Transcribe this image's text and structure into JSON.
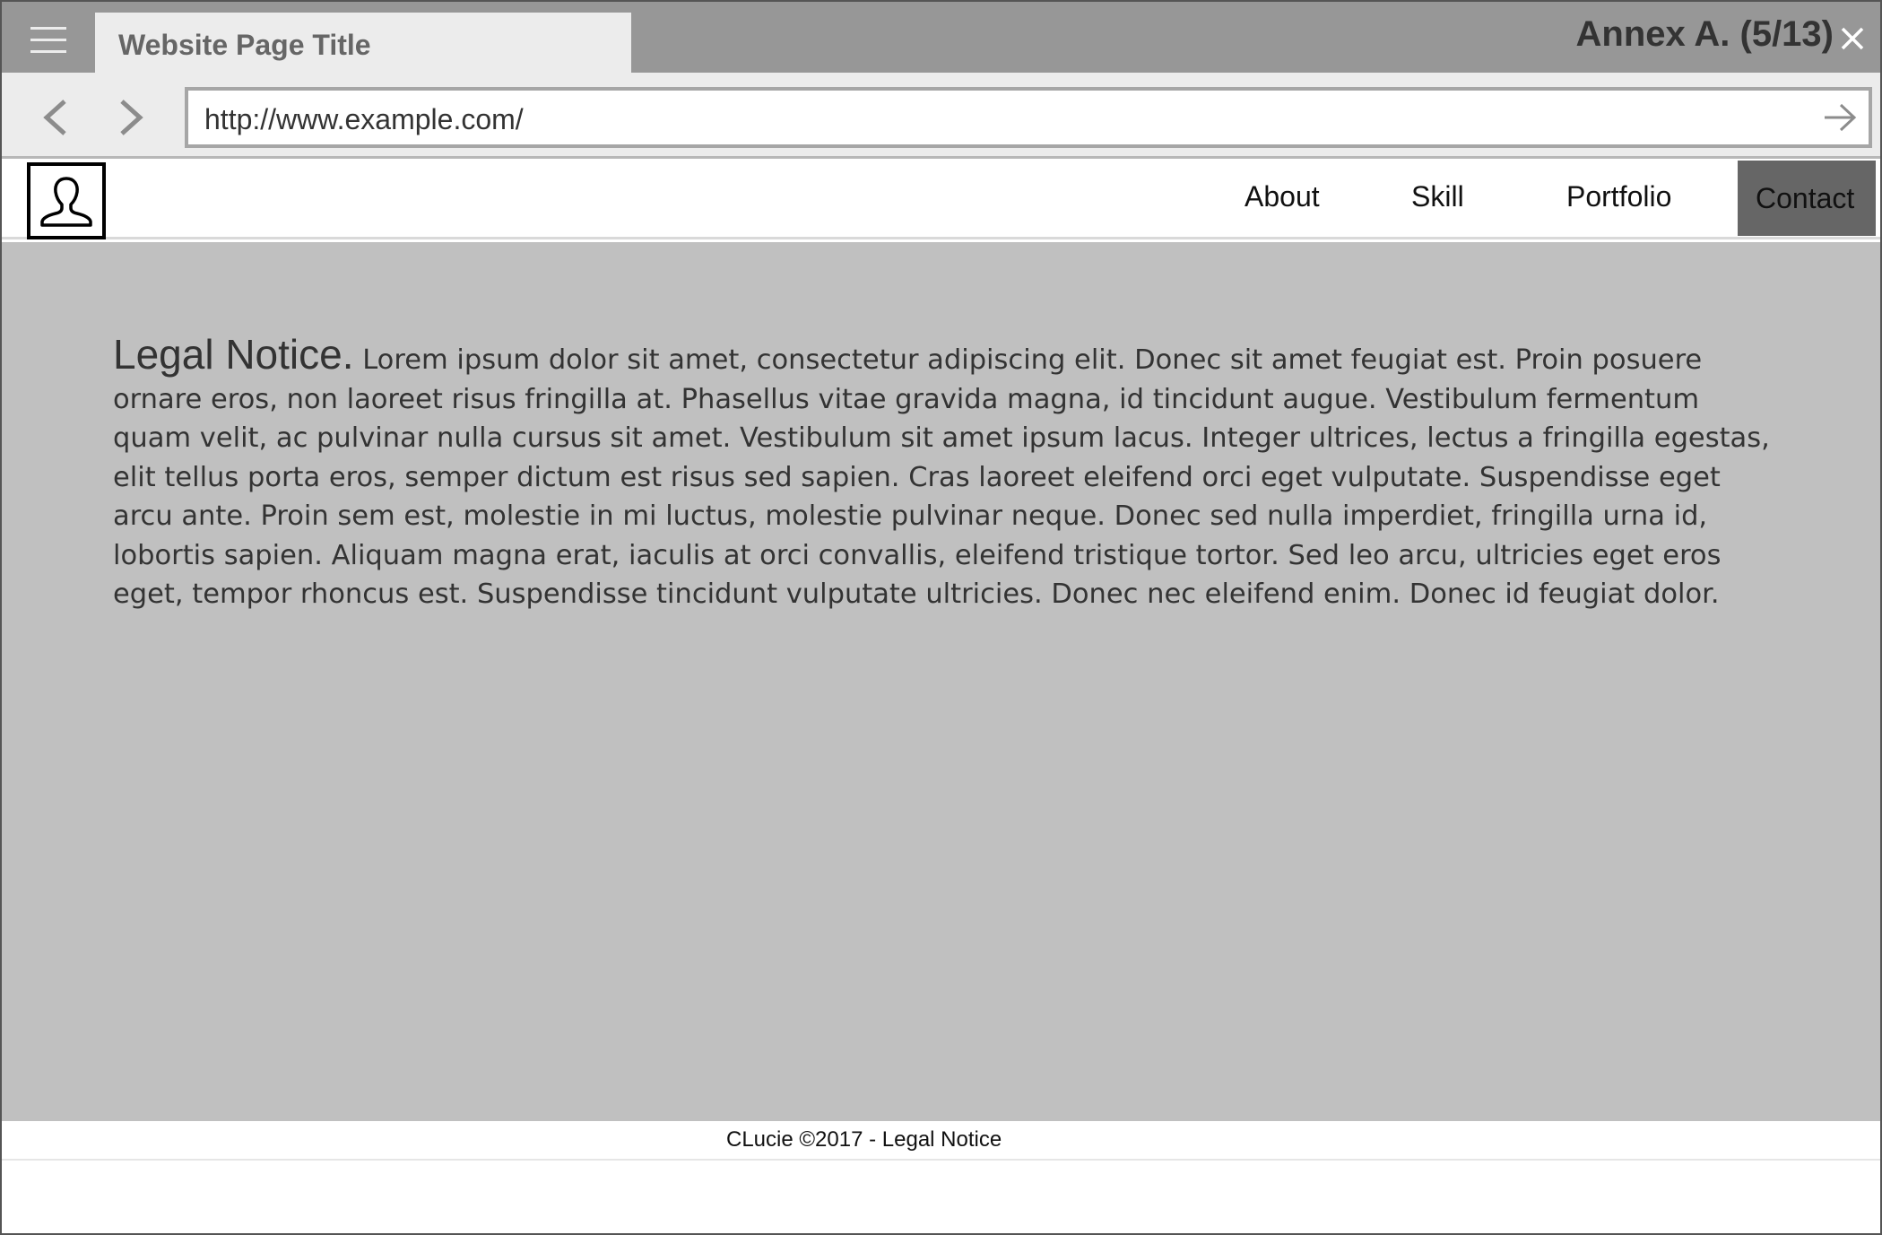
{
  "window": {
    "tab_title": "Website Page Title",
    "annex_label": "Annex A. (5/13)",
    "icons": {
      "menu": "hamburger-menu-icon",
      "close": "close-icon"
    }
  },
  "address_bar": {
    "url": "http://www.example.com/",
    "icons": {
      "back": "chevron-left-icon",
      "forward": "chevron-right-icon",
      "go": "arrow-right-icon"
    }
  },
  "site_header": {
    "logo_icon": "user-silhouette-icon",
    "menu": [
      {
        "label": "About"
      },
      {
        "label": "Skill"
      },
      {
        "label": "Portfolio"
      },
      {
        "label": "Contact",
        "active": true
      }
    ]
  },
  "main": {
    "heading": "Legal Notice.",
    "body": "Lorem ipsum dolor sit amet, consectetur adipiscing elit. Donec sit amet feugiat est. Proin posuere ornare eros, non laoreet risus fringilla at. Phasellus vitae gravida magna, id tincidunt augue. Vestibulum fermentum quam velit, ac pulvinar nulla cursus sit amet. Vestibulum sit amet ipsum lacus. Integer ultrices, lectus a fringilla egestas, elit tellus porta eros, semper dictum est risus sed sapien. Cras laoreet eleifend orci eget vulputate. Suspendisse eget arcu ante. Proin sem est, molestie in mi luctus, molestie pulvinar neque. Donec sed nulla imperdiet, fringilla urna id, lobortis sapien. Aliquam magna erat, iaculis at orci convallis, eleifend tristique tortor. Sed leo arcu, ultricies eget eros eget, tempor rhoncus est. Suspendisse tincidunt vulputate ultricies. Donec nec eleifend enim. Donec id feugiat dolor."
  },
  "footer": {
    "text": "CLucie ©2017 - Legal Notice"
  },
  "colors": {
    "titlebar": "#979797",
    "tab": "#ececec",
    "content_bg": "#c0c0c0",
    "active_menu": "#666666"
  }
}
